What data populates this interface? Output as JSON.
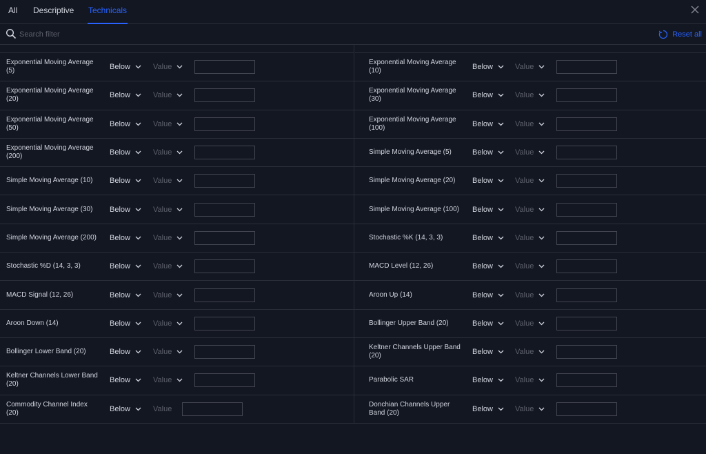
{
  "tabs": [
    {
      "label": "All",
      "active": false
    },
    {
      "label": "Descriptive",
      "active": false
    },
    {
      "label": "Technicals",
      "active": true
    }
  ],
  "search": {
    "placeholder": "Search filter"
  },
  "reset_label": "Reset all",
  "colors": {
    "background": "#131722",
    "accent": "#2962ff",
    "border": "#2a2e39",
    "text": "#d1d4dc",
    "muted": "#5d606b"
  },
  "icons": {
    "close": "close-icon",
    "search": "search-icon",
    "reset": "reset-icon",
    "dropdown": "chevron-down-icon"
  },
  "rows": [
    {
      "left": {
        "label": "Exponential Moving Average (5)",
        "condition": "Below",
        "value": "Value"
      },
      "right": {
        "label": "Exponential Moving Average (10)",
        "condition": "Below",
        "value": "Value"
      }
    },
    {
      "left": {
        "label": "Exponential Moving Average (20)",
        "condition": "Below",
        "value": "Value"
      },
      "right": {
        "label": "Exponential Moving Average (30)",
        "condition": "Below",
        "value": "Value"
      }
    },
    {
      "left": {
        "label": "Exponential Moving Average (50)",
        "condition": "Below",
        "value": "Value"
      },
      "right": {
        "label": "Exponential Moving Average (100)",
        "condition": "Below",
        "value": "Value"
      }
    },
    {
      "left": {
        "label": "Exponential Moving Average (200)",
        "condition": "Below",
        "value": "Value"
      },
      "right": {
        "label": "Simple Moving Average (5)",
        "condition": "Below",
        "value": "Value"
      }
    },
    {
      "left": {
        "label": "Simple Moving Average (10)",
        "condition": "Below",
        "value": "Value"
      },
      "right": {
        "label": "Simple Moving Average (20)",
        "condition": "Below",
        "value": "Value"
      }
    },
    {
      "left": {
        "label": "Simple Moving Average (30)",
        "condition": "Below",
        "value": "Value"
      },
      "right": {
        "label": "Simple Moving Average (100)",
        "condition": "Below",
        "value": "Value"
      }
    },
    {
      "left": {
        "label": "Simple Moving Average (200)",
        "condition": "Below",
        "value": "Value"
      },
      "right": {
        "label": "Stochastic %K (14, 3, 3)",
        "condition": "Below",
        "value": "Value"
      }
    },
    {
      "left": {
        "label": "Stochastic %D (14, 3, 3)",
        "condition": "Below",
        "value": "Value"
      },
      "right": {
        "label": "MACD Level (12, 26)",
        "condition": "Below",
        "value": "Value"
      }
    },
    {
      "left": {
        "label": "MACD Signal (12, 26)",
        "condition": "Below",
        "value": "Value"
      },
      "right": {
        "label": "Aroon Up (14)",
        "condition": "Below",
        "value": "Value"
      }
    },
    {
      "left": {
        "label": "Aroon Down (14)",
        "condition": "Below",
        "value": "Value"
      },
      "right": {
        "label": "Bollinger Upper Band (20)",
        "condition": "Below",
        "value": "Value"
      }
    },
    {
      "left": {
        "label": "Bollinger Lower Band (20)",
        "condition": "Below",
        "value": "Value"
      },
      "right": {
        "label": "Keltner Channels Upper Band (20)",
        "condition": "Below",
        "value": "Value"
      }
    },
    {
      "left": {
        "label": "Keltner Channels Lower Band (20)",
        "condition": "Below",
        "value": "Value"
      },
      "right": {
        "label": "Parabolic SAR",
        "condition": "Below",
        "value": "Value"
      }
    },
    {
      "left": {
        "label": "Commodity Channel Index (20)",
        "condition": "Below",
        "value": "Value",
        "value_dropdown": false
      },
      "right": {
        "label": "Donchian Channels Upper Band (20)",
        "condition": "Below",
        "value": "Value"
      }
    }
  ]
}
